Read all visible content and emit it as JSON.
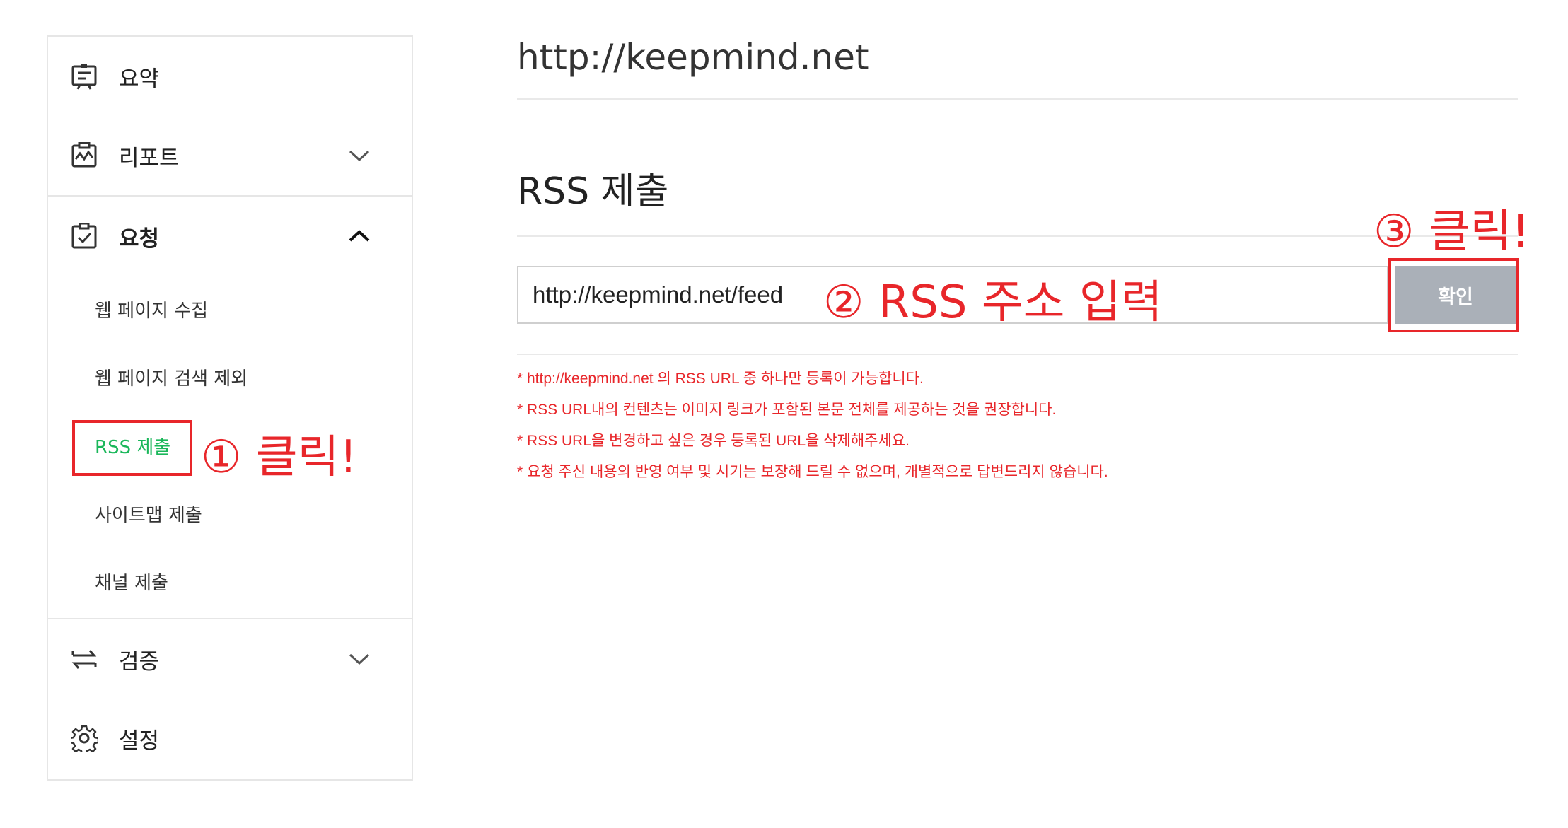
{
  "sidebar": {
    "summary_label": "요약",
    "report_label": "리포트",
    "request_label": "요청",
    "request_items": [
      "웹 페이지 수집",
      "웹 페이지 검색 제외",
      "RSS 제출",
      "사이트맵 제출",
      "채널 제출"
    ],
    "verify_label": "검증",
    "settings_label": "설정"
  },
  "main": {
    "site_url": "http://keepmind.net",
    "section_title": "RSS 제출",
    "rss_input_value": "http://keepmind.net/feed",
    "confirm_label": "확인",
    "notes": [
      "* http://keepmind.net 의 RSS URL 중 하나만 등록이 가능합니다.",
      "* RSS URL내의 컨텐츠는 이미지 링크가 포함된 본문 전체를 제공하는 것을 권장합니다.",
      "* RSS URL을 변경하고 싶은 경우 등록된 URL을 삭제해주세요.",
      "* 요청 주신 내용의 반영 여부 및 시기는 보장해 드릴 수 없으며, 개별적으로 답변드리지 않습니다."
    ]
  },
  "annotations": {
    "step1": "① 클릭!",
    "step2": "② RSS 주소 입력",
    "step3": "③ 클릭!"
  },
  "colors": {
    "annotation_red": "#e8262a",
    "active_green": "#1ab75a",
    "button_gray": "#aab0b8"
  },
  "icons": [
    "summary-icon",
    "report-icon",
    "request-icon",
    "verify-icon",
    "settings-icon",
    "chevron-down-icon",
    "chevron-up-icon"
  ]
}
